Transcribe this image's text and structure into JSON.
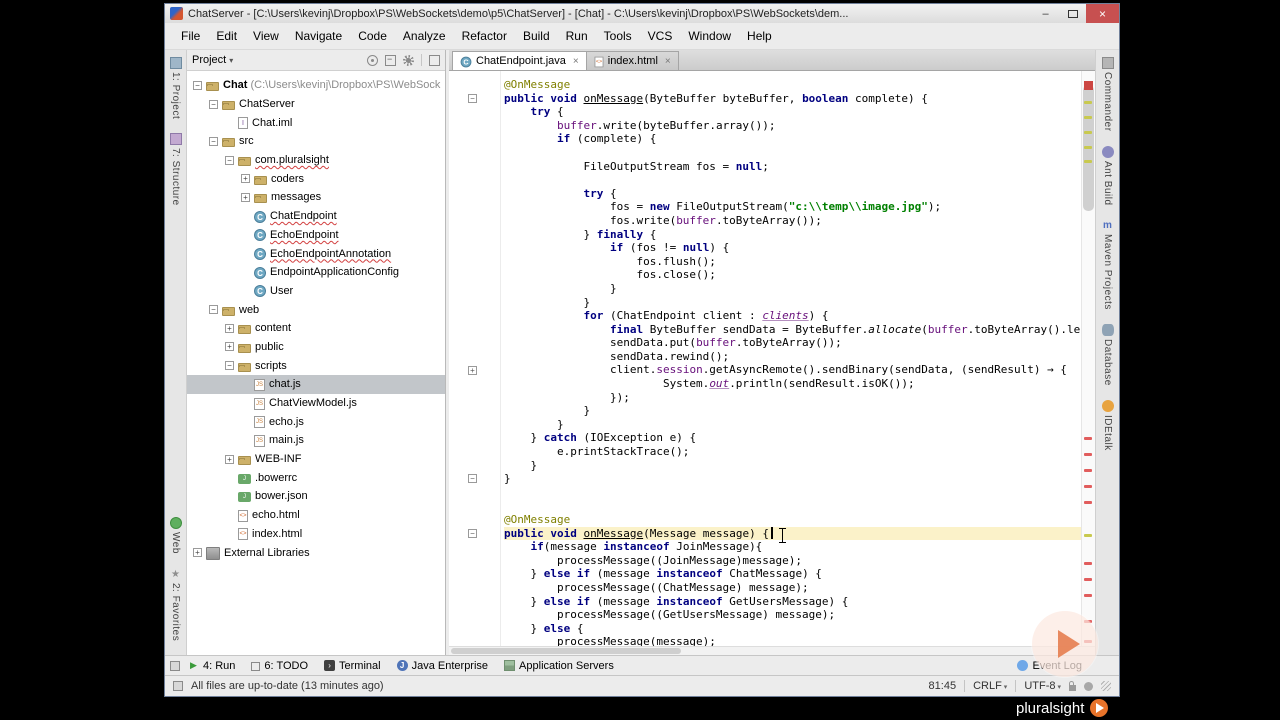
{
  "window": {
    "title": "ChatServer - [C:\\Users\\kevinj\\Dropbox\\PS\\WebSockets\\demo\\p5\\ChatServer] - [Chat] - C:\\Users\\kevinj\\Dropbox\\PS\\WebSockets\\dem..."
  },
  "menu": {
    "items": [
      "File",
      "Edit",
      "View",
      "Navigate",
      "Code",
      "Analyze",
      "Refactor",
      "Build",
      "Run",
      "Tools",
      "VCS",
      "Window",
      "Help"
    ]
  },
  "left_stripe": {
    "top": [
      {
        "icon": "project-tool",
        "label": "1: Project"
      },
      {
        "icon": "structure-tool",
        "label": "7: Structure"
      }
    ],
    "bottom": [
      {
        "icon": "web-tool",
        "label": "Web"
      },
      {
        "icon": "favorites-tool",
        "label": "2: Favorites"
      }
    ]
  },
  "right_stripe": {
    "items": [
      {
        "icon": "commander",
        "label": "Commander"
      },
      {
        "icon": "ant",
        "label": "Ant Build"
      },
      {
        "icon": "maven",
        "label": "Maven Projects"
      },
      {
        "icon": "database",
        "label": "Database"
      },
      {
        "icon": "idetalk",
        "label": "IDEtalk"
      }
    ]
  },
  "project_panel": {
    "title": "Project",
    "header_icons": [
      "locate",
      "collapse",
      "gear",
      "hide"
    ],
    "tree": [
      {
        "level": 0,
        "expander": "-",
        "icon": "project",
        "label": "Chat",
        "bold": true,
        "suffix": " (C:\\Users\\kevinj\\Dropbox\\PS\\WebSock"
      },
      {
        "level": 1,
        "expander": "-",
        "icon": "folder",
        "label": "ChatServer"
      },
      {
        "level": 2,
        "expander": "",
        "icon": "iml",
        "label": "Chat.iml"
      },
      {
        "level": 1,
        "expander": "-",
        "icon": "folder-src",
        "label": "src"
      },
      {
        "level": 2,
        "expander": "-",
        "icon": "package",
        "label": "com.pluralsight",
        "error": true
      },
      {
        "level": 3,
        "expander": "+",
        "icon": "package",
        "label": "coders"
      },
      {
        "level": 3,
        "expander": "+",
        "icon": "package",
        "label": "messages"
      },
      {
        "level": 3,
        "expander": "",
        "icon": "class",
        "label": "ChatEndpoint",
        "error": true
      },
      {
        "level": 3,
        "expander": "",
        "icon": "class",
        "label": "EchoEndpoint",
        "error": true
      },
      {
        "level": 3,
        "expander": "",
        "icon": "class",
        "label": "EchoEndpointAnnotation",
        "error": true
      },
      {
        "level": 3,
        "expander": "",
        "icon": "class",
        "label": "EndpointApplicationConfig"
      },
      {
        "level": 3,
        "expander": "",
        "icon": "class",
        "label": "User"
      },
      {
        "level": 1,
        "expander": "-",
        "icon": "folder",
        "label": "web"
      },
      {
        "level": 2,
        "expander": "+",
        "icon": "folder",
        "label": "content"
      },
      {
        "level": 2,
        "expander": "+",
        "icon": "folder",
        "label": "public"
      },
      {
        "level": 2,
        "expander": "-",
        "icon": "folder",
        "label": "scripts"
      },
      {
        "level": 3,
        "expander": "",
        "icon": "js",
        "label": "chat.js",
        "selected": true
      },
      {
        "level": 3,
        "expander": "",
        "icon": "js",
        "label": "ChatViewModel.js"
      },
      {
        "level": 3,
        "expander": "",
        "icon": "js",
        "label": "echo.js"
      },
      {
        "level": 3,
        "expander": "",
        "icon": "js",
        "label": "main.js"
      },
      {
        "level": 2,
        "expander": "+",
        "icon": "folder",
        "label": "WEB-INF"
      },
      {
        "level": 2,
        "expander": "",
        "icon": "json",
        "label": ".bowerrc"
      },
      {
        "level": 2,
        "expander": "",
        "icon": "json",
        "label": "bower.json"
      },
      {
        "level": 2,
        "expander": "",
        "icon": "html",
        "label": "echo.html"
      },
      {
        "level": 2,
        "expander": "",
        "icon": "html",
        "label": "index.html"
      },
      {
        "level": 0,
        "expander": "+",
        "icon": "extlib",
        "label": "External Libraries"
      }
    ]
  },
  "editor": {
    "tabs": [
      {
        "label": "ChatEndpoint.java",
        "icon": "class",
        "active": true
      },
      {
        "label": "index.html",
        "icon": "html",
        "active": false
      }
    ],
    "code": {
      "current_line": 34,
      "folds": {
        "2": "-",
        "22": "+",
        "30": "-",
        "34": "-"
      },
      "lines": [
        [
          [
            "a",
            "@OnMessage"
          ]
        ],
        [
          [
            "k",
            "public"
          ],
          [
            "p",
            " "
          ],
          [
            "k",
            "void"
          ],
          [
            "p",
            " "
          ],
          [
            "m",
            "onMessage"
          ],
          [
            "p",
            "(ByteBuffer byteBuffer, "
          ],
          [
            "k",
            "boolean"
          ],
          [
            "p",
            " complete) {"
          ]
        ],
        [
          [
            "p",
            "    "
          ],
          [
            "k",
            "try"
          ],
          [
            "p",
            " {"
          ]
        ],
        [
          [
            "p",
            "        "
          ],
          [
            "f",
            "buffer"
          ],
          [
            "p",
            ".write(byteBuffer.array());"
          ]
        ],
        [
          [
            "p",
            "        "
          ],
          [
            "k",
            "if"
          ],
          [
            "p",
            " (complete) {"
          ]
        ],
        [],
        [
          [
            "p",
            "            FileOutputStream fos = "
          ],
          [
            "k",
            "null"
          ],
          [
            "p",
            ";"
          ]
        ],
        [],
        [
          [
            "p",
            "            "
          ],
          [
            "k",
            "try"
          ],
          [
            "p",
            " {"
          ]
        ],
        [
          [
            "p",
            "                fos = "
          ],
          [
            "k",
            "new"
          ],
          [
            "p",
            " FileOutputStream("
          ],
          [
            "s",
            "\"c:\\\\temp\\\\image.jpg\""
          ],
          [
            "p",
            ");"
          ]
        ],
        [
          [
            "p",
            "                fos.write("
          ],
          [
            "f",
            "buffer"
          ],
          [
            "p",
            ".toByteArray());"
          ]
        ],
        [
          [
            "p",
            "            } "
          ],
          [
            "k",
            "finally"
          ],
          [
            "p",
            " {"
          ]
        ],
        [
          [
            "p",
            "                "
          ],
          [
            "k",
            "if"
          ],
          [
            "p",
            " (fos != "
          ],
          [
            "k",
            "null"
          ],
          [
            "p",
            ") {"
          ]
        ],
        [
          [
            "p",
            "                    fos.flush();"
          ]
        ],
        [
          [
            "p",
            "                    fos.close();"
          ]
        ],
        [
          [
            "p",
            "                }"
          ]
        ],
        [
          [
            "p",
            "            }"
          ]
        ],
        [
          [
            "p",
            "            "
          ],
          [
            "k",
            "for"
          ],
          [
            "p",
            " (ChatEndpoint client : "
          ],
          [
            "fi",
            "clients"
          ],
          [
            "p",
            ") {"
          ]
        ],
        [
          [
            "p",
            "                "
          ],
          [
            "k",
            "final"
          ],
          [
            "p",
            " ByteBuffer sendData = ByteBuffer."
          ],
          [
            "i",
            "allocate"
          ],
          [
            "p",
            "("
          ],
          [
            "f",
            "buffer"
          ],
          [
            "p",
            ".toByteArray().leng"
          ]
        ],
        [
          [
            "p",
            "                sendData.put("
          ],
          [
            "f",
            "buffer"
          ],
          [
            "p",
            ".toByteArray());"
          ]
        ],
        [
          [
            "p",
            "                sendData.rewind();"
          ]
        ],
        [
          [
            "p",
            "                client."
          ],
          [
            "f",
            "session"
          ],
          [
            "p",
            ".getAsyncRemote().sendBinary(sendData, (sendResult) → {"
          ]
        ],
        [
          [
            "p",
            "                        System."
          ],
          [
            "fi",
            "out"
          ],
          [
            "p",
            ".println(sendResult.isOK());"
          ]
        ],
        [
          [
            "p",
            "                });"
          ]
        ],
        [
          [
            "p",
            "            }"
          ]
        ],
        [
          [
            "p",
            "        }"
          ]
        ],
        [
          [
            "p",
            "    } "
          ],
          [
            "k",
            "catch"
          ],
          [
            "p",
            " (IOException e) {"
          ]
        ],
        [
          [
            "p",
            "        e.printStackTrace();"
          ]
        ],
        [
          [
            "p",
            "    }"
          ]
        ],
        [
          [
            "p",
            "}"
          ]
        ],
        [],
        [],
        [
          [
            "a",
            "@OnMessage"
          ]
        ],
        [
          [
            "k",
            "public"
          ],
          [
            "p",
            " "
          ],
          [
            "k",
            "void"
          ],
          [
            "p",
            " "
          ],
          [
            "m",
            "onMessage"
          ],
          [
            "p",
            "(Message message) {"
          ]
        ],
        [
          [
            "p",
            "    "
          ],
          [
            "k",
            "if"
          ],
          [
            "p",
            "(message "
          ],
          [
            "k",
            "instanceof"
          ],
          [
            "p",
            " JoinMessage){"
          ]
        ],
        [
          [
            "p",
            "        processMessage((JoinMessage)message);"
          ]
        ],
        [
          [
            "p",
            "    } "
          ],
          [
            "k",
            "else"
          ],
          [
            "p",
            " "
          ],
          [
            "k",
            "if"
          ],
          [
            "p",
            " (message "
          ],
          [
            "k",
            "instanceof"
          ],
          [
            "p",
            " ChatMessage) {"
          ]
        ],
        [
          [
            "p",
            "        processMessage((ChatMessage) message);"
          ]
        ],
        [
          [
            "p",
            "    } "
          ],
          [
            "k",
            "else"
          ],
          [
            "p",
            " "
          ],
          [
            "k",
            "if"
          ],
          [
            "p",
            " (message "
          ],
          [
            "k",
            "instanceof"
          ],
          [
            "p",
            " GetUsersMessage) {"
          ]
        ],
        [
          [
            "p",
            "        processMessage((GetUsersMessage) message);"
          ]
        ],
        [
          [
            "p",
            "    } "
          ],
          [
            "k",
            "else"
          ],
          [
            "p",
            " {"
          ]
        ],
        [
          [
            "p",
            "        processMessage(message);"
          ]
        ]
      ]
    },
    "stripe": {
      "validator": {
        "t": 10,
        "c": "#cc4642"
      },
      "colors": {
        "yellow": "#c8c94f",
        "red": "#e15d5d"
      },
      "marks": [
        {
          "t": 30,
          "c": "#c8c94f"
        },
        {
          "t": 45,
          "c": "#c8c94f"
        },
        {
          "t": 60,
          "c": "#c8c94f"
        },
        {
          "t": 75,
          "c": "#c8c94f"
        },
        {
          "t": 89,
          "c": "#c8c94f"
        },
        {
          "t": 366,
          "c": "#e15d5d"
        },
        {
          "t": 382,
          "c": "#e15d5d"
        },
        {
          "t": 398,
          "c": "#e15d5d"
        },
        {
          "t": 414,
          "c": "#e15d5d"
        },
        {
          "t": 430,
          "c": "#e15d5d"
        },
        {
          "t": 463,
          "c": "#c8c94f"
        },
        {
          "t": 491,
          "c": "#e15d5d"
        },
        {
          "t": 507,
          "c": "#e15d5d"
        },
        {
          "t": 523,
          "c": "#e15d5d"
        },
        {
          "t": 549,
          "c": "#e15d5d"
        },
        {
          "t": 569,
          "c": "#e15d5d"
        }
      ]
    }
  },
  "bottom_bar": {
    "left": [
      {
        "icon": "run",
        "label": "4: Run"
      },
      {
        "icon": "todo",
        "label": "6: TODO"
      },
      {
        "icon": "terminal",
        "label": "Terminal"
      },
      {
        "icon": "javaee",
        "label": "Java Enterprise"
      },
      {
        "icon": "appservers",
        "label": "Application Servers"
      }
    ],
    "right": [
      {
        "icon": "eventlog",
        "label": "Event Log"
      }
    ]
  },
  "status_bar": {
    "message": "All files are up-to-date (13 minutes ago)",
    "position": "81:45",
    "line_separator": "CRLF",
    "encoding": "UTF-8"
  },
  "overlay": {
    "watermark": "pluralsight"
  }
}
